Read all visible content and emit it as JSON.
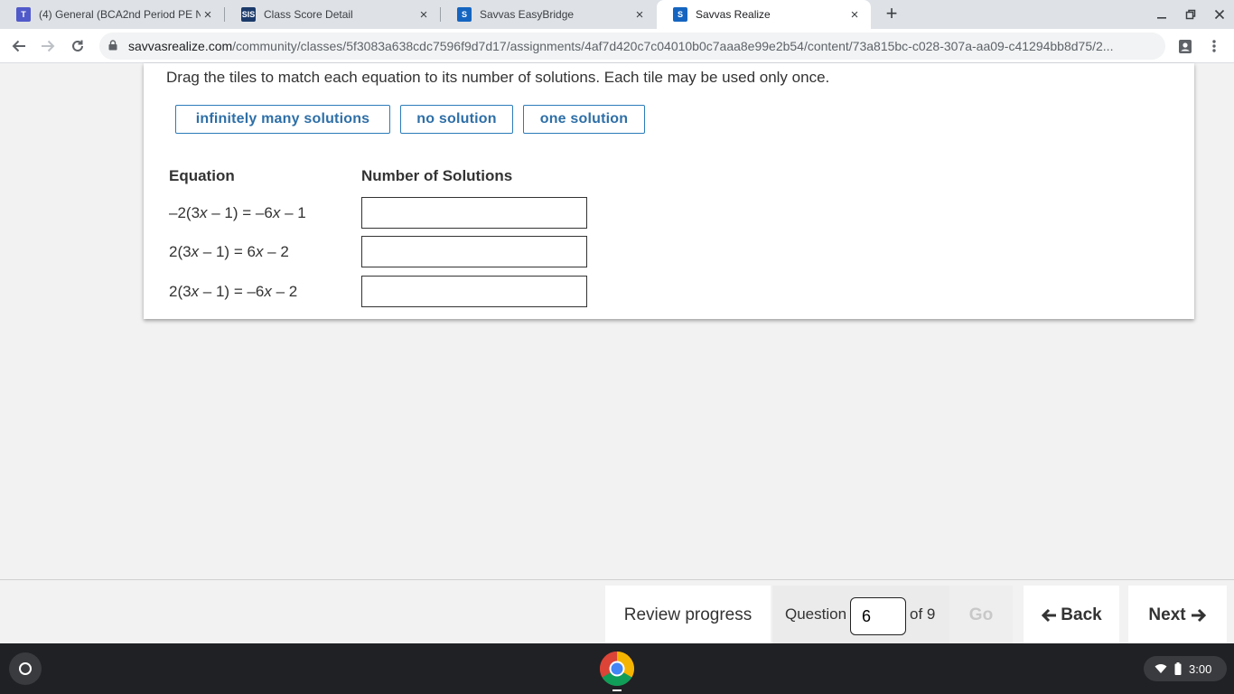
{
  "browser": {
    "tabs": [
      {
        "title": "(4) General (BCA2nd Period PE N",
        "icon": "teams-icon",
        "color": "#5059c9",
        "close": "×"
      },
      {
        "title": "Class Score Detail",
        "icon": "sis-icon",
        "color": "#1b3a6b",
        "close": "×"
      },
      {
        "title": "Savvas EasyBridge",
        "icon": "savvas-icon",
        "color": "#1565c0",
        "close": "×"
      },
      {
        "title": "Savvas Realize",
        "icon": "savvas-icon",
        "color": "#1565c0",
        "close": "×"
      }
    ],
    "sis_badge": "SIS",
    "new_tab": "+",
    "url_host": "savvasrealize.com",
    "url_path": "/community/classes/5f3083a638cdc7596f9d7d17/assignments/4af7d420c7c04010b0c7aaa8e99e2b54/content/73a815bc-c028-307a-aa09-c41294bb8d75/2..."
  },
  "question": {
    "instructions": "Drag the tiles to match each equation to its number of solutions. Each tile may be used only once.",
    "tiles": [
      "infinitely many solutions",
      "no solution",
      "one solution"
    ],
    "column_headers": {
      "equation": "Equation",
      "solutions": "Number of Solutions"
    },
    "rows": [
      {
        "parts": [
          "–2(3",
          "x",
          " – 1) = –6",
          "x",
          " – 1"
        ]
      },
      {
        "parts": [
          "2(3",
          "x",
          " – 1) = 6",
          "x",
          " – 2"
        ]
      },
      {
        "parts": [
          "2(3",
          "x",
          " – 1) = –6",
          "x",
          " – 2"
        ]
      }
    ]
  },
  "navigation": {
    "review_progress": "Review progress",
    "question_label": "Question",
    "current_question": "6",
    "of_total": "of 9",
    "go": "Go",
    "back": "Back",
    "next": "Next"
  },
  "shelf": {
    "time": "3:00"
  },
  "colors": {
    "accent": "#2b7bb9",
    "tile_text": "#2e6fa7"
  }
}
